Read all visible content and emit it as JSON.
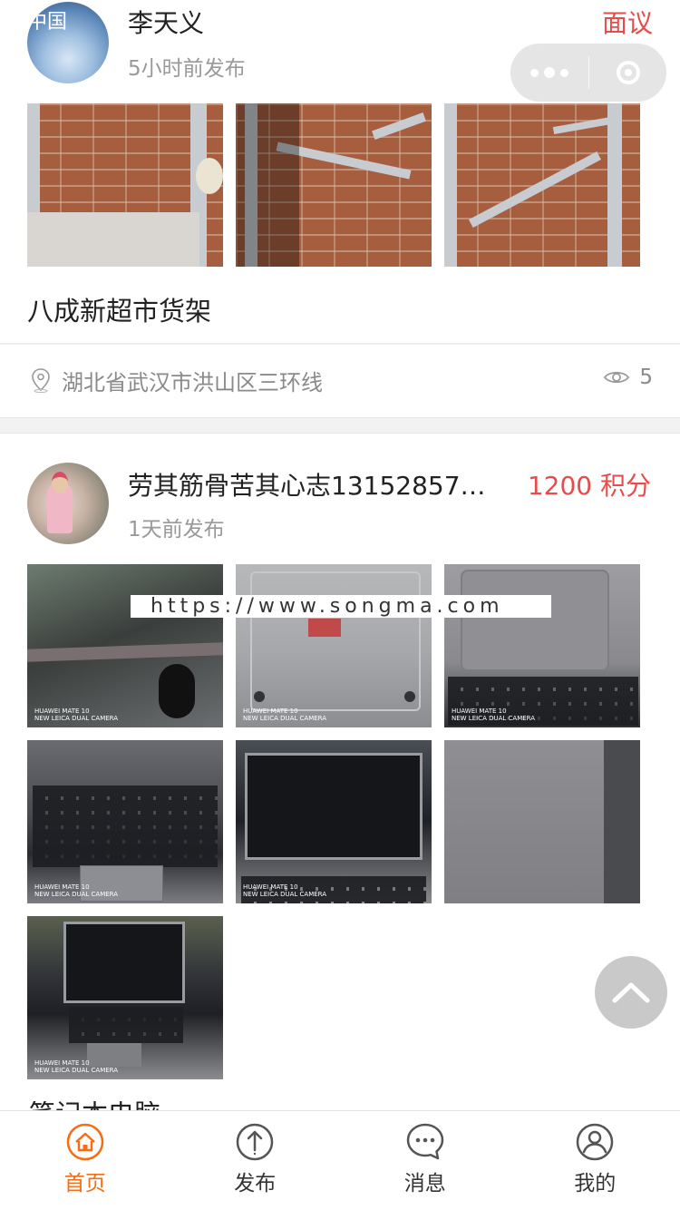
{
  "capsule": {
    "more_icon": "more-dots-icon",
    "close_icon": "close-circle-icon"
  },
  "posts": [
    {
      "user": "李天义",
      "avatar_overlay": "中国",
      "time": "5小时前发布",
      "points": "面议",
      "description": "八成新超市货架",
      "location": "湖北省武汉市洪山区三环线",
      "views": "5"
    },
    {
      "user": "劳其筋骨苦其心志13152857…",
      "time": "1天前发布",
      "points": "1200 积分",
      "watermark": "https://www.songma.com",
      "photo_caption": "HUAWEI MATE 10\nNEW LEICA DUAL CAMERA"
    }
  ],
  "next_post": {
    "description": "笔记本电脑"
  },
  "tabbar": {
    "items": [
      {
        "label": "首页",
        "icon": "home-icon",
        "active": true
      },
      {
        "label": "发布",
        "icon": "upload-icon",
        "active": false
      },
      {
        "label": "消息",
        "icon": "message-icon",
        "active": false
      },
      {
        "label": "我的",
        "icon": "user-icon",
        "active": false
      }
    ]
  },
  "colors": {
    "accent": "#f56d14",
    "price": "#e84b4b",
    "secondary_text": "#999999"
  }
}
